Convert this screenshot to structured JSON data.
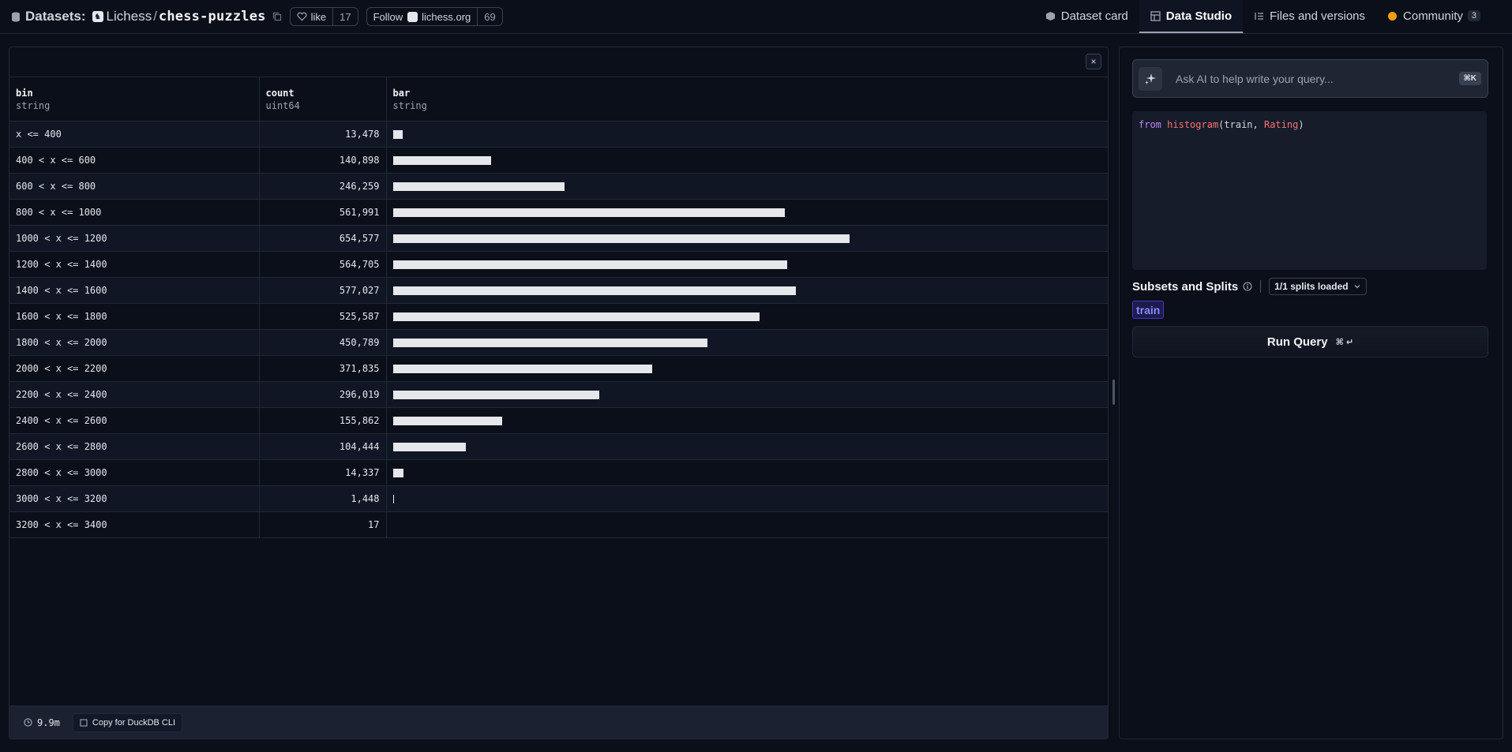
{
  "header": {
    "datasets_label": "Datasets:",
    "org": "Lichess",
    "separator": "/",
    "repo": "chess-puzzles",
    "like_label": "like",
    "like_count": "17",
    "follow_label": "Follow",
    "follow_org": "lichess.org",
    "follow_count": "69",
    "tabs": [
      {
        "label": "Dataset card",
        "icon": "dataset-card-icon",
        "active": false
      },
      {
        "label": "Data Studio",
        "icon": "table-icon",
        "active": true
      },
      {
        "label": "Files and versions",
        "icon": "files-icon",
        "active": false
      },
      {
        "label": "Community",
        "icon": "community-icon",
        "active": false,
        "badge": "3"
      }
    ]
  },
  "table": {
    "columns": [
      {
        "name": "bin",
        "type": "string"
      },
      {
        "name": "count",
        "type": "uint64"
      },
      {
        "name": "bar",
        "type": "string"
      }
    ],
    "rows": [
      {
        "bin": "x <= 400",
        "count": "13,478",
        "value": 13478
      },
      {
        "bin": "400 < x <= 600",
        "count": "140,898",
        "value": 140898
      },
      {
        "bin": "600 < x <= 800",
        "count": "246,259",
        "value": 246259
      },
      {
        "bin": "800 < x <= 1000",
        "count": "561,991",
        "value": 561991
      },
      {
        "bin": "1000 < x <= 1200",
        "count": "654,577",
        "value": 654577
      },
      {
        "bin": "1200 < x <= 1400",
        "count": "564,705",
        "value": 564705
      },
      {
        "bin": "1400 < x <= 1600",
        "count": "577,027",
        "value": 577027
      },
      {
        "bin": "1600 < x <= 1800",
        "count": "525,587",
        "value": 525587
      },
      {
        "bin": "1800 < x <= 2000",
        "count": "450,789",
        "value": 450789
      },
      {
        "bin": "2000 < x <= 2200",
        "count": "371,835",
        "value": 371835
      },
      {
        "bin": "2200 < x <= 2400",
        "count": "296,019",
        "value": 296019
      },
      {
        "bin": "2400 < x <= 2600",
        "count": "155,862",
        "value": 155862
      },
      {
        "bin": "2600 < x <= 2800",
        "count": "104,444",
        "value": 104444
      },
      {
        "bin": "2800 < x <= 3000",
        "count": "14,337",
        "value": 14337
      },
      {
        "bin": "3000 < x <= 3200",
        "count": "1,448",
        "value": 1448
      },
      {
        "bin": "3200 < x <= 3400",
        "count": "17",
        "value": 17
      }
    ]
  },
  "footer": {
    "elapsed": "9.9m",
    "copy_label": "Copy for DuckDB CLI"
  },
  "close_label": "×",
  "right": {
    "ai_placeholder": "Ask AI to help write your query...",
    "ai_shortcut": "⌘K",
    "query": {
      "keyword": "from",
      "function": "histogram",
      "open": "(",
      "arg1": "train",
      "comma": ", ",
      "arg2": "Rating",
      "close": ")"
    },
    "subsets_label": "Subsets and Splits",
    "splits_loaded": "1/1 splits loaded",
    "split_name": "train",
    "run_label": "Run Query",
    "run_shortcut": "⌘ ↵"
  },
  "colors": {
    "background": "#0b0f19",
    "bar": "#e5e7eb",
    "split_chip": "#818cf8",
    "keyword": "#c084fc",
    "function": "#f87171"
  }
}
